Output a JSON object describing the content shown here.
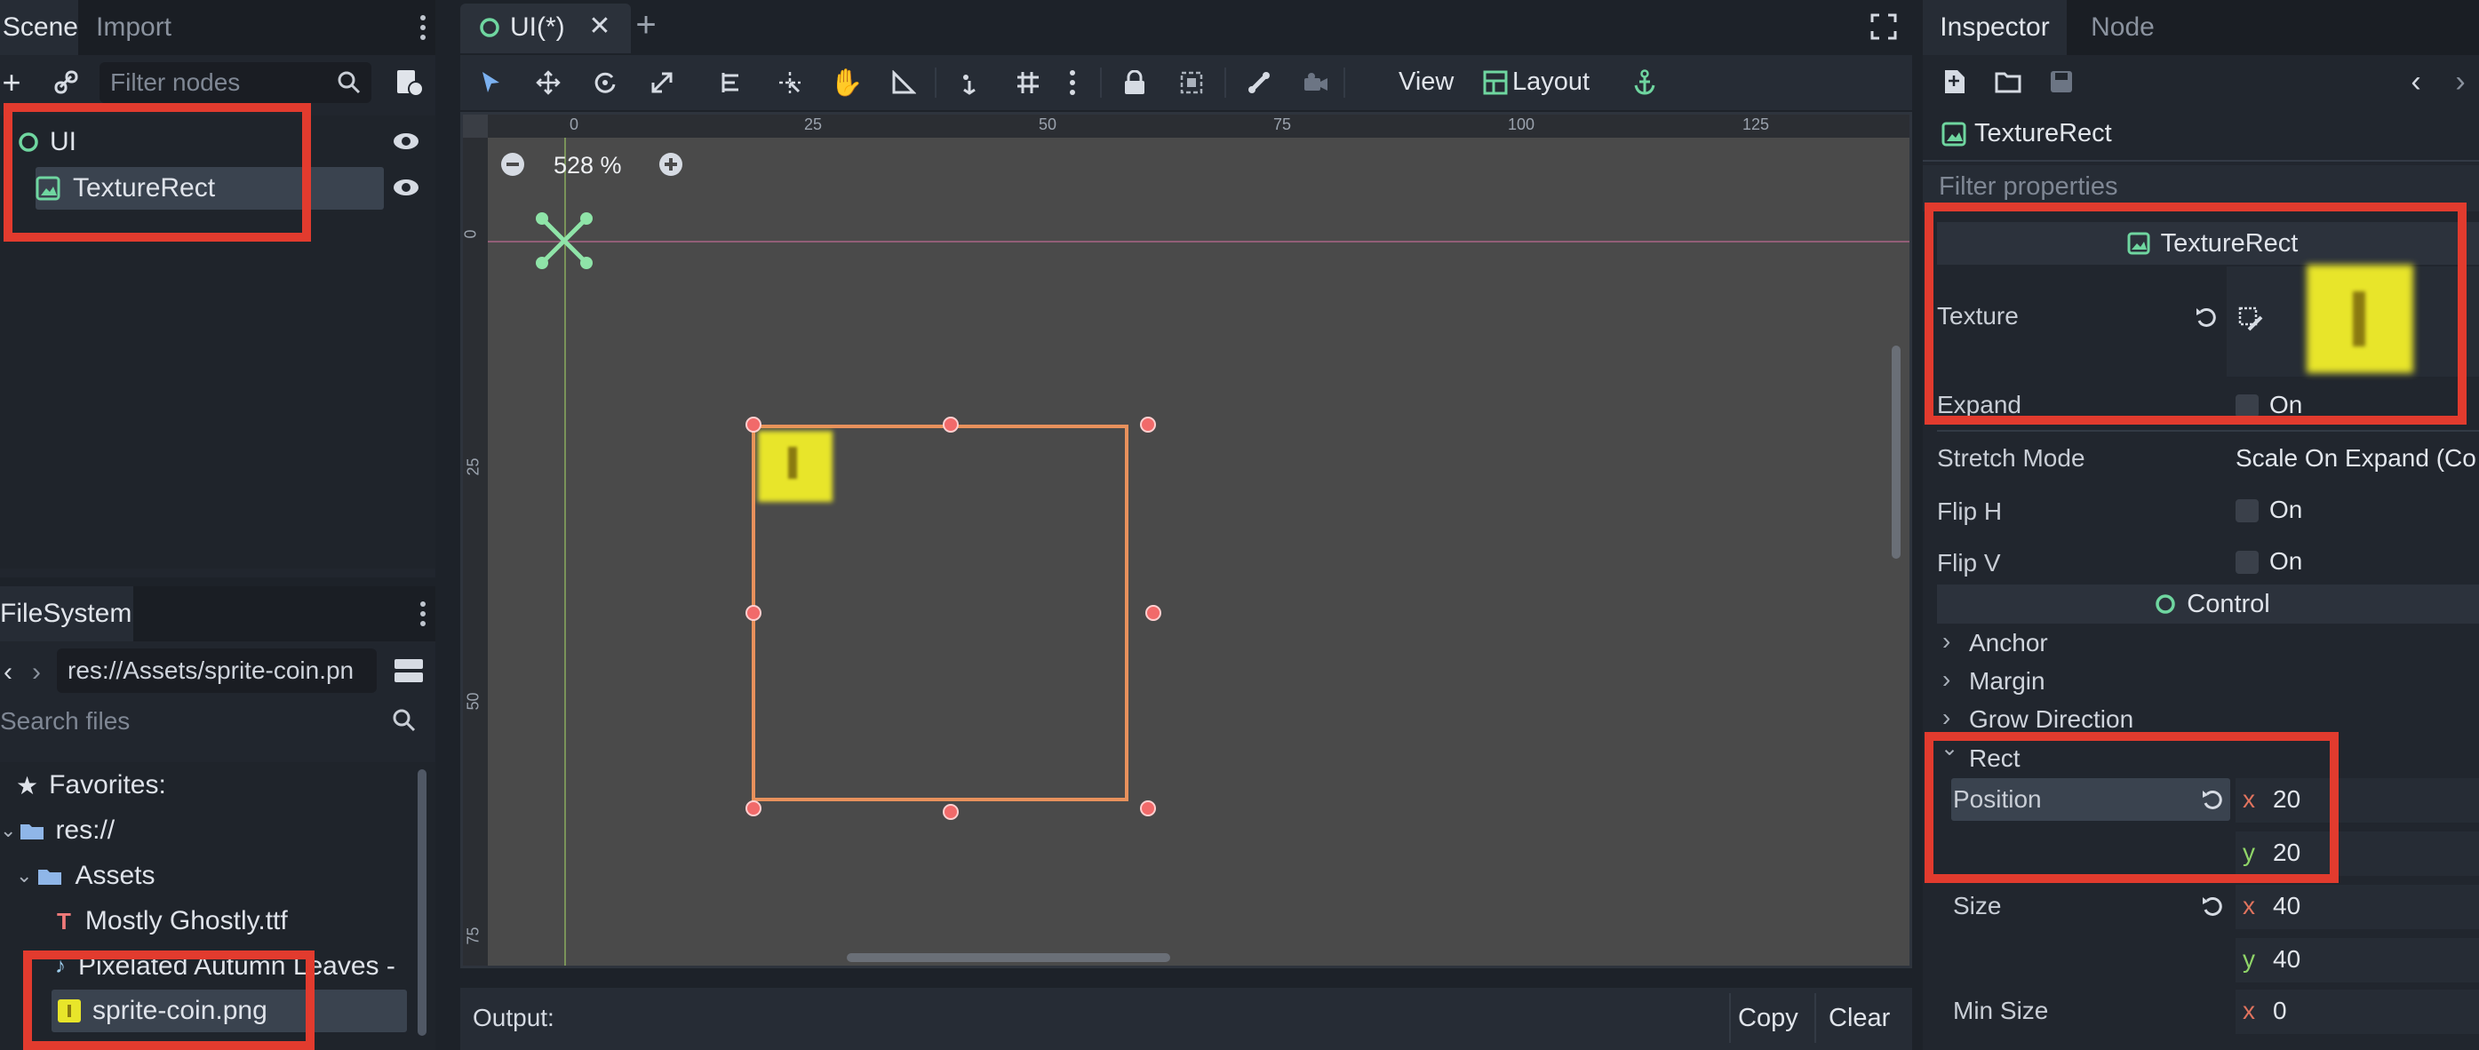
{
  "scene_dock": {
    "tabs": [
      "Scene",
      "Import"
    ],
    "filter_placeholder": "Filter nodes",
    "nodes": [
      {
        "name": "UI",
        "icon": "control-node-icon"
      },
      {
        "name": "TextureRect",
        "icon": "texture-rect-icon"
      }
    ]
  },
  "filesystem": {
    "tab": "FileSystem",
    "path": "res://Assets/sprite-coin.pn",
    "search_placeholder": "Search files",
    "items": [
      {
        "label": "Favorites:",
        "icon": "star-icon"
      },
      {
        "label": "res://",
        "icon": "folder-icon"
      },
      {
        "label": "Assets",
        "icon": "folder-icon"
      },
      {
        "label": "Mostly Ghostly.ttf",
        "icon": "font-file-icon"
      },
      {
        "label": "Pixelated Autumn Leaves -",
        "icon": "audio-file-icon"
      },
      {
        "label": "sprite-coin.png",
        "icon": "image-file-icon"
      }
    ]
  },
  "editor": {
    "tab_title": "UI(*)",
    "toolbar": {
      "view_label": "View",
      "layout_label": "Layout"
    },
    "zoom": "528 %",
    "ruler_h": [
      "0",
      "25",
      "50",
      "75",
      "100",
      "125"
    ],
    "ruler_v": [
      "0",
      "25",
      "50",
      "75"
    ],
    "output_label": "Output:",
    "copy_label": "Copy",
    "clear_label": "Clear"
  },
  "inspector": {
    "tabs": [
      "Inspector",
      "Node"
    ],
    "object_name": "TextureRect",
    "filter_placeholder": "Filter properties",
    "section_texture_rect": "TextureRect",
    "texture_label": "Texture",
    "expand_label": "Expand",
    "expand_value": "On",
    "stretch_mode_label": "Stretch Mode",
    "stretch_mode_value": "Scale On Expand (Co",
    "flip_h_label": "Flip H",
    "flip_h_value": "On",
    "flip_v_label": "Flip V",
    "flip_v_value": "On",
    "section_control": "Control",
    "groups": [
      "Anchor",
      "Margin",
      "Grow Direction",
      "Rect"
    ],
    "position_label": "Position",
    "position_x": "20",
    "position_y": "20",
    "size_label": "Size",
    "size_x": "40",
    "size_y": "40",
    "min_size_label": "Min Size",
    "min_size_x": "0",
    "x_axis": "x",
    "y_axis": "y"
  },
  "colors": {
    "accent": "#6fd6a0",
    "highlight_box": "#e23b2e",
    "selection_rect": "#e8915c",
    "coin_yellow": "#e8e52a"
  }
}
